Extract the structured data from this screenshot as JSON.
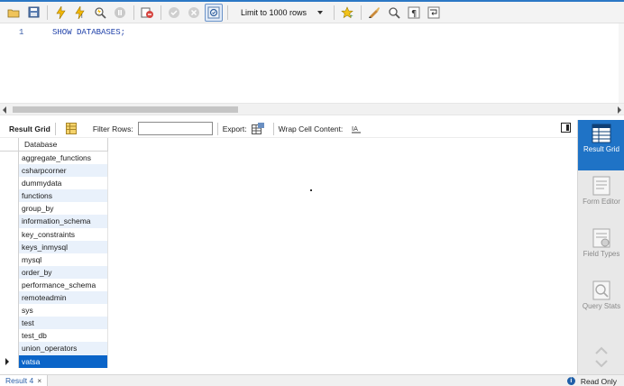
{
  "toolbar": {
    "limit_label": "Limit to 1000 rows",
    "buttons": [
      "open-folder-icon",
      "save-icon",
      "execute-icon",
      "execute-current-icon",
      "explain-icon",
      "stop-icon",
      "toggle-error-icon",
      "commit-icon",
      "rollback-icon",
      "autocommit-icon",
      "bookmark-star-icon",
      "beautify-icon",
      "find-icon",
      "invisible-chars-icon",
      "wrap-icon"
    ]
  },
  "editor": {
    "line_number": "1",
    "sql": "SHOW DATABASES;"
  },
  "results_toolbar": {
    "result_grid_label": "Result Grid",
    "filter_label": "Filter Rows:",
    "filter_value": "",
    "export_label": "Export:",
    "wrap_label": "Wrap Cell Content:"
  },
  "grid": {
    "column": "Database",
    "rows": [
      "aggregate_functions",
      "csharpcorner",
      "dummydata",
      "functions",
      "group_by",
      "information_schema",
      "key_constraints",
      "keys_inmysql",
      "mysql",
      "order_by",
      "performance_schema",
      "remoteadmin",
      "sys",
      "test",
      "test_db",
      "union_operators",
      "vatsa"
    ],
    "selected_row": "vatsa"
  },
  "side_panel": {
    "result_grid": "Result Grid",
    "form_editor": "Form Editor",
    "field_types": "Field Types",
    "query_stats": "Query Stats"
  },
  "status": {
    "tab_label": "Result 4",
    "close": "×",
    "readonly": "Read Only"
  },
  "colors": {
    "accent": "#1f73c6",
    "selection": "#0a64c8",
    "alt_row": "#e9f1fb"
  }
}
